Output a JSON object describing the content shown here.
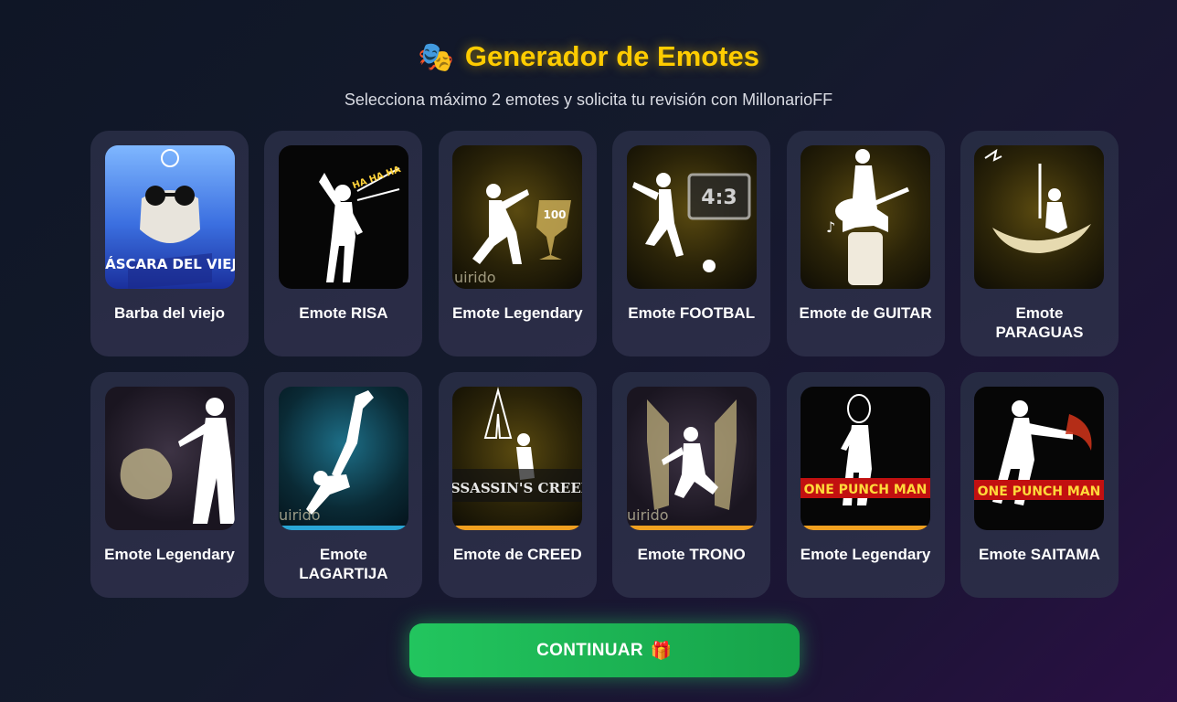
{
  "header": {
    "icon": "theater-masks-icon",
    "title": "Generador de Emotes"
  },
  "subtitle": "Selecciona máximo 2 emotes y solicita tu revisión con MillonarioFF",
  "emotes": [
    {
      "label": "Barba del viejo",
      "image_text": "MÁSCARA DEL VIEJO",
      "icon": "bearded-mask-icon"
    },
    {
      "label": "Emote RISA",
      "image_text": "HA HA HA",
      "icon": "laughing-figure-icon"
    },
    {
      "label": "Emote Legendary",
      "image_text": "100",
      "icon": "kneeling-trophy-figure-icon"
    },
    {
      "label": "Emote FOOTBAL",
      "image_text": "4:3",
      "icon": "football-kick-icon"
    },
    {
      "label": "Emote de GUITAR",
      "image_text": "",
      "icon": "guitar-player-icon"
    },
    {
      "label": "Emote PARAGUAS",
      "image_text": "",
      "icon": "umbrella-boat-icon"
    },
    {
      "label": "Emote Legendary",
      "image_text": "",
      "icon": "wolf-companion-icon"
    },
    {
      "label": "Emote LAGARTIJA",
      "image_text": "uirido",
      "icon": "breakdance-figure-icon"
    },
    {
      "label": "Emote de CREED",
      "image_text": "ASSASSIN'S CREED",
      "icon": "assassins-creed-icon"
    },
    {
      "label": "Emote TRONO",
      "image_text": "uirido",
      "icon": "throne-figure-icon"
    },
    {
      "label": "Emote Legendary",
      "image_text": "ONE PUNCH MAN",
      "icon": "one-punch-saitama-icon"
    },
    {
      "label": "Emote SAITAMA",
      "image_text": "ONE PUNCH MAN",
      "icon": "saitama-punch-icon"
    }
  ],
  "continue_button": {
    "label": "CONTINUAR",
    "icon": "gift-icon"
  },
  "colors": {
    "title": "#ffcc00",
    "button": "#22c55e",
    "card": "#262b42"
  }
}
